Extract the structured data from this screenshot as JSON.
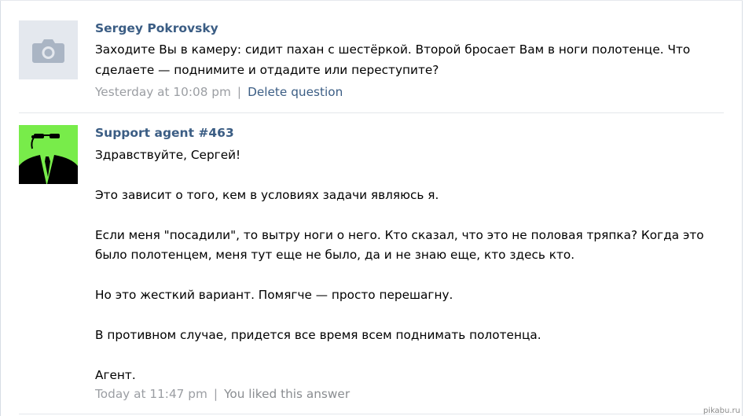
{
  "question": {
    "author": "Sergey Pokrovsky",
    "text": "Заходите Вы в камеру: сидит пахан с шестёркой. Второй бросает Вам в ноги полотенце. Что сделаете — поднимите и отдадите или переступите?",
    "time": "Yesterday at 10:08 pm",
    "separator": "|",
    "action": "Delete question"
  },
  "answer": {
    "author": "Support agent #463",
    "paragraphs": [
      "Здравствуйте, Сергей!",
      "Это зависит о того, кем в условиях задачи являюсь я.",
      "Если меня \"посадили\", то вытру ноги о него. Кто сказал, что это не половая тряпка? Когда это было полотенцем, меня тут еще не было, да и не знаю еще, кто здесь кто.",
      "Но это жесткий вариант. Помягче — просто перешагну.",
      "В противном случае, придется все время всем поднимать полотенца.",
      "Агент."
    ],
    "time": "Today at 11:47 pm",
    "separator": "|",
    "status": "You liked this answer"
  },
  "watermark": "pikabu.ru",
  "colors": {
    "author_link": "#3b5d84",
    "meta_gray": "#9b9ea3",
    "agent_avatar_bg": "#78ec4a",
    "default_avatar_bg": "#e4e8ee"
  },
  "icons": {
    "question_avatar": "camera-icon",
    "answer_avatar": "agent-silhouette-icon"
  }
}
